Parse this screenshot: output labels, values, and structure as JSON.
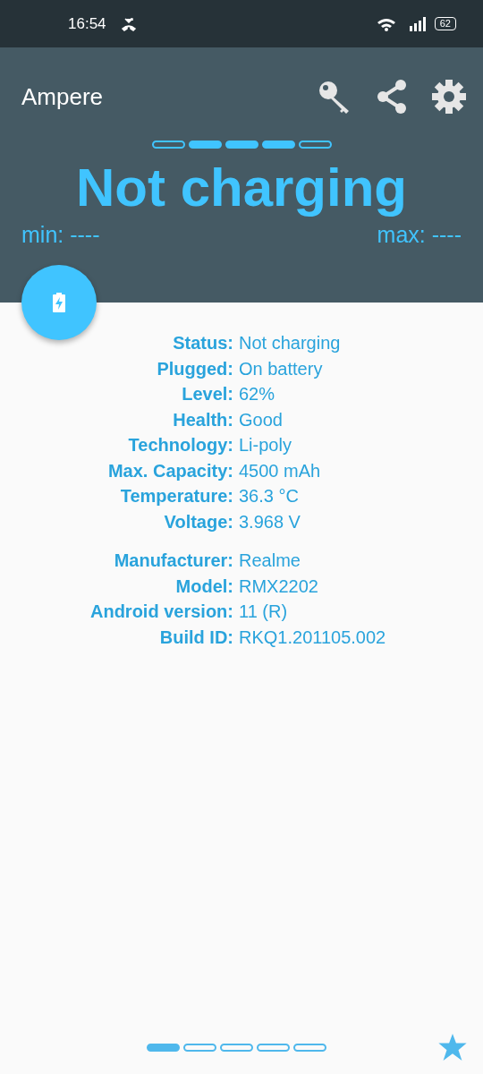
{
  "status_bar": {
    "time": "16:54",
    "battery": "62"
  },
  "app_bar": {
    "title": "Ampere"
  },
  "charge_indicator": {
    "segments": [
      {
        "on": false
      },
      {
        "on": true
      },
      {
        "on": true
      },
      {
        "on": true
      },
      {
        "on": false
      }
    ]
  },
  "headline": "Not charging",
  "min": "min: ----",
  "max": "max: ----",
  "info_groups": [
    [
      {
        "label": "Status:",
        "value": "Not charging"
      },
      {
        "label": "Plugged:",
        "value": "On battery"
      },
      {
        "label": "Level:",
        "value": "62%"
      },
      {
        "label": "Health:",
        "value": "Good"
      },
      {
        "label": "Technology:",
        "value": "Li-poly"
      },
      {
        "label": "Max. Capacity:",
        "value": "4500 mAh"
      },
      {
        "label": "Temperature:",
        "value": "36.3 °C"
      },
      {
        "label": "Voltage:",
        "value": "3.968 V"
      }
    ],
    [
      {
        "label": "Manufacturer:",
        "value": "Realme"
      },
      {
        "label": "Model:",
        "value": "RMX2202"
      },
      {
        "label": "Android version:",
        "value": "11 (R)"
      },
      {
        "label": "Build ID:",
        "value": "RKQ1.201105.002"
      }
    ]
  ],
  "pager": {
    "pages": [
      {
        "selected": true
      },
      {
        "selected": false
      },
      {
        "selected": false
      },
      {
        "selected": false
      },
      {
        "selected": false
      }
    ]
  }
}
